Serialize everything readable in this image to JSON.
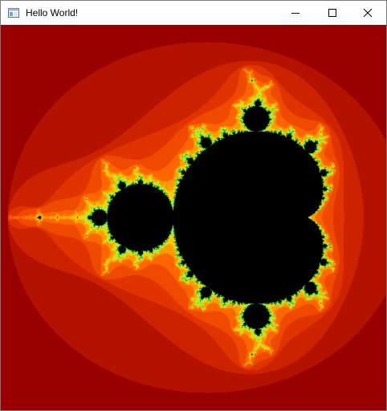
{
  "window": {
    "title": "Hello World!"
  },
  "titlebar": {
    "app_icon": "window-app-icon",
    "buttons": {
      "minimize": "minimize-icon",
      "maximize": "maximize-icon",
      "close": "close-icon"
    }
  },
  "client": {
    "content": "mandelbrot-fractal",
    "colors": {
      "background": "#990000",
      "band_1": "#b31200",
      "band_2": "#cc2200",
      "band_3": "#e03300",
      "band_4": "#f04a00",
      "band_5": "#ff6600",
      "band_6": "#ff9a00",
      "band_7": "#ffcc00",
      "edge_1": "#88ff44",
      "edge_2": "#2f8f2f",
      "inside": "#000000"
    }
  }
}
